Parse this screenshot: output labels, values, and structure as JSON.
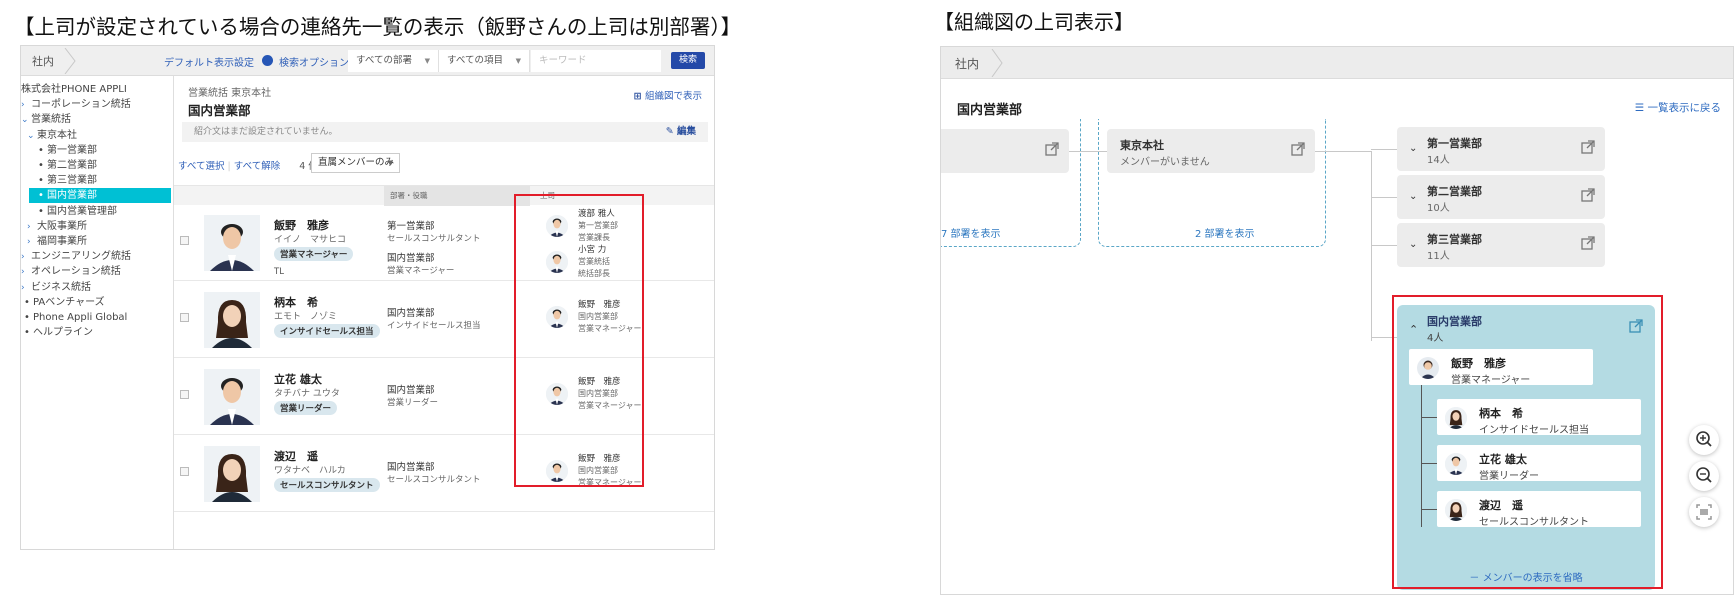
{
  "captions": {
    "left": "【上司が設定されている場合の連絡先一覧の表示（飯野さんの上司は別部署）】",
    "right": "【組織図の上司表示】"
  },
  "left_panel": {
    "breadcrumb": "社内",
    "toolbar": {
      "default_view": "デフォルト表示設定",
      "search_options": "検索オプション",
      "dept_select": "すべての部署",
      "item_select": "すべての項目",
      "keyword_placeholder": "キーワード",
      "search_button": "検索"
    },
    "tree": [
      {
        "label": "株式会社PHONE APPLI",
        "indent": 0,
        "marker": "none"
      },
      {
        "label": "コーポレーション統括",
        "indent": 0,
        "marker": "chev-right"
      },
      {
        "label": "営業統括",
        "indent": 0,
        "marker": "chev-down"
      },
      {
        "label": "東京本社",
        "indent": 1,
        "marker": "chev-down"
      },
      {
        "label": "第一営業部",
        "indent": 2,
        "marker": "bullet"
      },
      {
        "label": "第二営業部",
        "indent": 2,
        "marker": "bullet"
      },
      {
        "label": "第三営業部",
        "indent": 2,
        "marker": "bullet"
      },
      {
        "label": "国内営業部",
        "indent": 2,
        "marker": "bullet",
        "active": true
      },
      {
        "label": "国内営業管理部",
        "indent": 2,
        "marker": "bullet"
      },
      {
        "label": "大阪事業所",
        "indent": 1,
        "marker": "chev-right"
      },
      {
        "label": "福岡事業所",
        "indent": 1,
        "marker": "chev-right"
      },
      {
        "label": "エンジニアリング統括",
        "indent": 0,
        "marker": "chev-right"
      },
      {
        "label": "オペレーション統括",
        "indent": 0,
        "marker": "chev-right"
      },
      {
        "label": "ビジネス統括",
        "indent": 0,
        "marker": "chev-right"
      },
      {
        "label": "PAベンチャーズ",
        "indent": 0,
        "marker": "bullet"
      },
      {
        "label": "Phone Appli Global",
        "indent": 0,
        "marker": "bullet"
      },
      {
        "label": "ヘルプライン",
        "indent": 0,
        "marker": "bullet"
      }
    ],
    "main": {
      "path": "営業統括 東京本社",
      "title": "国内営業部",
      "org_view_link": "組織図で表示",
      "intro": "紹介文はまだ設定されていません。",
      "edit": "編集",
      "select_all": "すべて選択",
      "deselect_all": "すべて解除",
      "count": "4 件",
      "filter": "直属メンバーのみ",
      "col_dept": "部署・役職",
      "col_boss": "上司"
    },
    "rows": [
      {
        "name": "飯野　雅彦",
        "kana": "イイノ　マサヒコ",
        "tag": "営業マネージャー",
        "extra": "TL",
        "depts": [
          {
            "dept": "第一営業部",
            "role": "セールスコンサルタント"
          },
          {
            "dept": "国内営業部",
            "role": "営業マネージャー"
          }
        ],
        "bosses": [
          {
            "name": "渡部 雅人",
            "dept": "第一営業部",
            "role": "営業課長"
          },
          {
            "name": "小宮 力",
            "dept": "営業統括",
            "role": "統括部長"
          }
        ]
      },
      {
        "name": "柄本　希",
        "kana": "エモト　ノゾミ",
        "tag": "インサイドセールス担当",
        "extra": "",
        "depts": [
          {
            "dept": "国内営業部",
            "role": "インサイドセールス担当"
          }
        ],
        "bosses": [
          {
            "name": "飯野　雅彦",
            "dept": "国内営業部",
            "role": "営業マネージャー"
          }
        ]
      },
      {
        "name": "立花 雄太",
        "kana": "タチバナ ユウタ",
        "tag": "営業リーダー",
        "extra": "",
        "depts": [
          {
            "dept": "国内営業部",
            "role": "営業リーダー"
          }
        ],
        "bosses": [
          {
            "name": "飯野　雅彦",
            "dept": "国内営業部",
            "role": "営業マネージャー"
          }
        ]
      },
      {
        "name": "渡辺　遥",
        "kana": "ワタナベ　ハルカ",
        "tag": "セールスコンサルタント",
        "extra": "",
        "depts": [
          {
            "dept": "国内営業部",
            "role": "セールスコンサルタント"
          }
        ],
        "bosses": [
          {
            "name": "飯野　雅彦",
            "dept": "国内営業部",
            "role": "営業マネージャー"
          }
        ]
      }
    ]
  },
  "right_panel": {
    "breadcrumb": "社内",
    "title": "国内営業部",
    "list_view_link": "一覧表示に戻る",
    "partial_link": "7 部署を表示",
    "tokyo": {
      "name": "東京本社",
      "sub": "メンバーがいません",
      "link": "2 部署を表示"
    },
    "depts": [
      {
        "name": "第一営業部",
        "count": "14人"
      },
      {
        "name": "第二営業部",
        "count": "10人"
      },
      {
        "name": "第三営業部",
        "count": "11人"
      }
    ],
    "selected": {
      "name": "国内営業部",
      "count": "4人",
      "manager": {
        "name": "飯野　雅彦",
        "role": "営業マネージャー"
      },
      "members": [
        {
          "name": "柄本　希",
          "role": "インサイドセールス担当"
        },
        {
          "name": "立花 雄太",
          "role": "営業リーダー"
        },
        {
          "name": "渡辺　遥",
          "role": "セールスコンサルタント"
        }
      ],
      "omit_link": "－ メンバーの表示を省略"
    }
  },
  "colors": {
    "accent": "#00c0d4",
    "link": "#3060b8",
    "highlight_box": "#e21d2a",
    "selected_node": "#b4dbe3"
  }
}
